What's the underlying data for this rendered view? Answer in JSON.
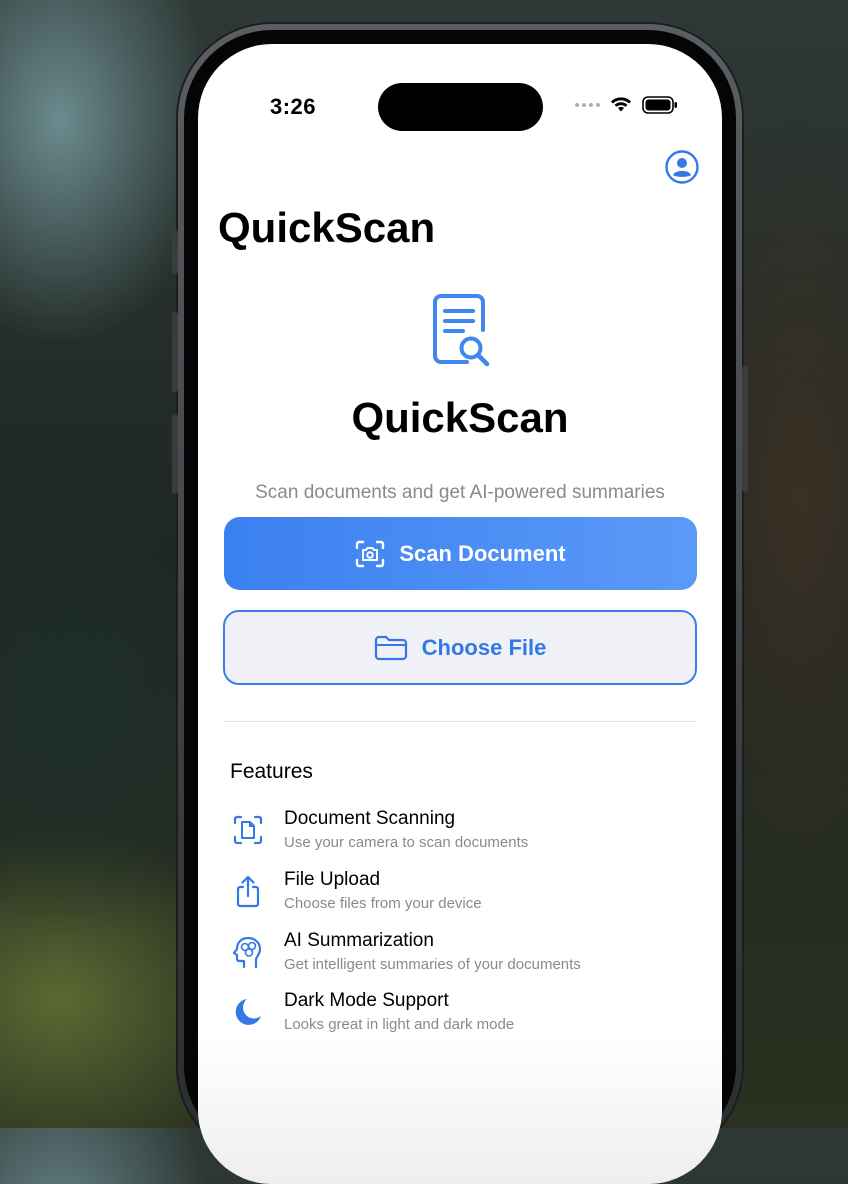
{
  "status_bar": {
    "time": "3:26"
  },
  "nav": {
    "title": "QuickScan",
    "profile_icon": "person-circle-icon"
  },
  "hero": {
    "icon": "document-magnifier-icon",
    "title": "QuickScan",
    "subtitle": "Scan documents and get AI-powered summaries"
  },
  "actions": {
    "scan_label": "Scan Document",
    "scan_icon": "camera-viewfinder-icon",
    "file_label": "Choose File",
    "file_icon": "folder-icon"
  },
  "features": {
    "heading": "Features",
    "items": [
      {
        "icon": "document-viewfinder-icon",
        "title": "Document Scanning",
        "desc": "Use your camera to scan documents"
      },
      {
        "icon": "share-upload-icon",
        "title": "File Upload",
        "desc": "Choose files from your device"
      },
      {
        "icon": "brain-head-icon",
        "title": "AI Summarization",
        "desc": "Get intelligent summaries of your documents"
      },
      {
        "icon": "moon-icon",
        "title": "Dark Mode Support",
        "desc": "Looks great in light and dark mode"
      }
    ]
  },
  "colors": {
    "accent": "#3478e6",
    "secondary_text": "#8a8a8e"
  }
}
